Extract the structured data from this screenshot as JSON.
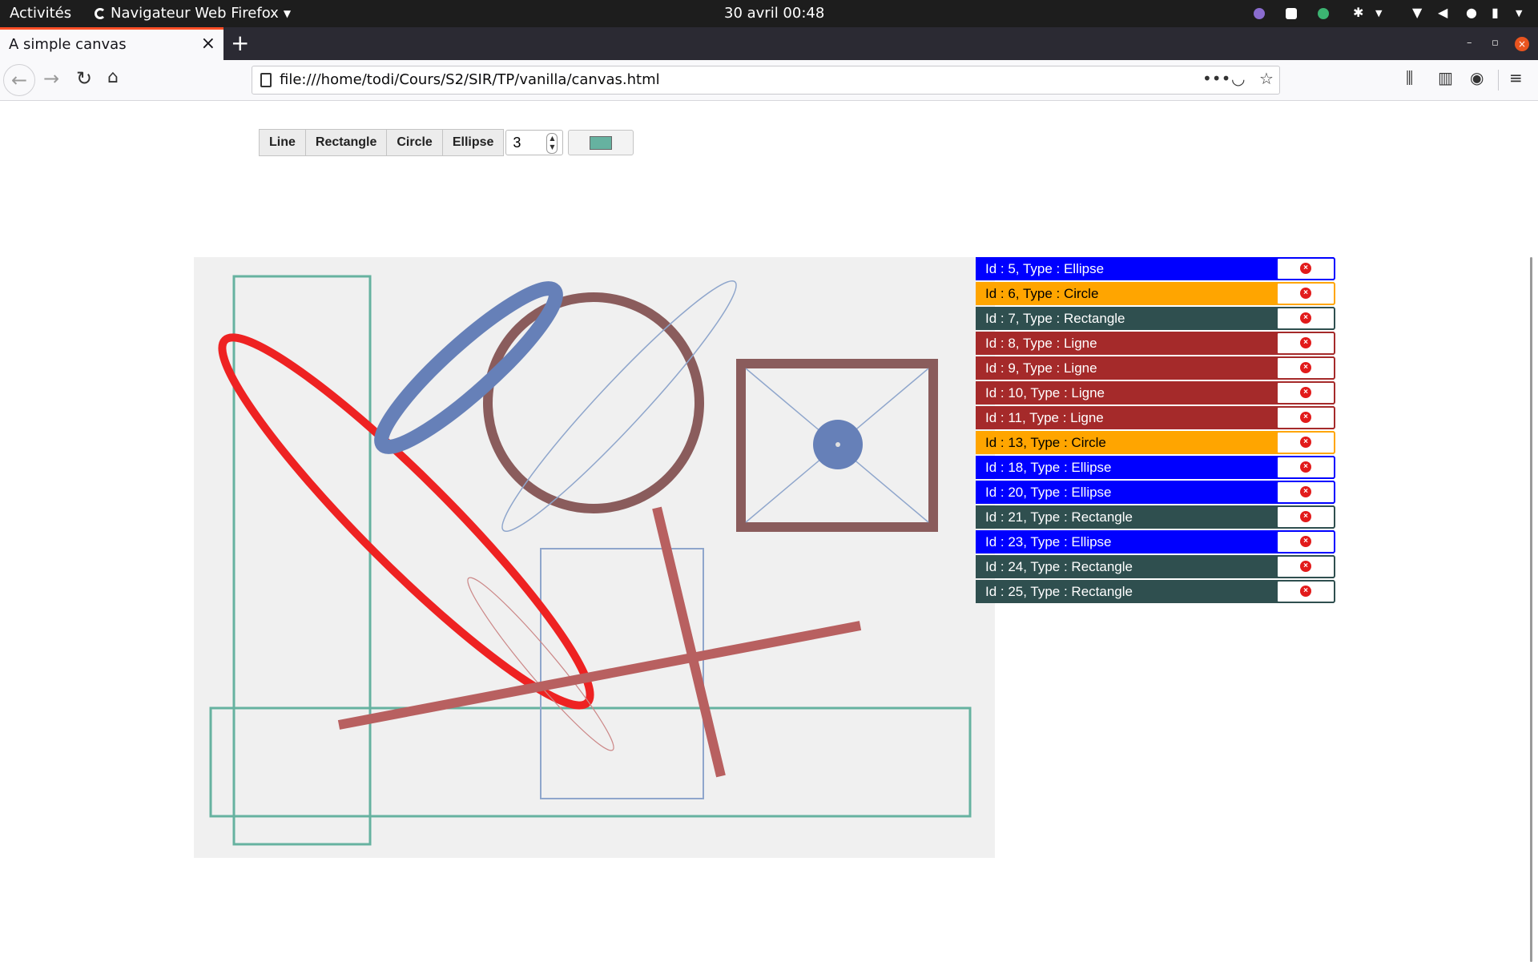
{
  "system_bar": {
    "activities": "Activités",
    "app_menu": "Navigateur Web Firefox",
    "clock": "30 avril  00:48"
  },
  "browser": {
    "tab_title": "A simple canvas",
    "url": "file:///home/todi/Cours/S2/SIR/TP/vanilla/canvas.html",
    "url_actions": [
      "more-actions-icon",
      "pocket-icon",
      "bookmark-star-icon"
    ],
    "toolbar_icons": [
      "library-icon",
      "sidebar-icon",
      "account-icon",
      "hamburger-menu-icon"
    ]
  },
  "toolbar": {
    "buttons": [
      "Line",
      "Rectangle",
      "Circle",
      "Ellipse"
    ],
    "thickness": "3",
    "color": "#66b2a0"
  },
  "shapes": [
    {
      "label": "Id : 5, Type : Ellipse",
      "bg": "#0000ff",
      "fg": "#ffffff",
      "border": "#0000ff"
    },
    {
      "label": "Id : 6, Type : Circle",
      "bg": "#ffa500",
      "fg": "#000000",
      "border": "#ffa500"
    },
    {
      "label": "Id : 7, Type : Rectangle",
      "bg": "#2f4f4f",
      "fg": "#ffffff",
      "border": "#2f4f4f"
    },
    {
      "label": "Id : 8, Type : Ligne",
      "bg": "#a52a2a",
      "fg": "#ffffff",
      "border": "#a52a2a"
    },
    {
      "label": "Id : 9, Type : Ligne",
      "bg": "#a52a2a",
      "fg": "#ffffff",
      "border": "#a52a2a"
    },
    {
      "label": "Id : 10, Type : Ligne",
      "bg": "#a52a2a",
      "fg": "#ffffff",
      "border": "#a52a2a"
    },
    {
      "label": "Id : 11, Type : Ligne",
      "bg": "#a52a2a",
      "fg": "#ffffff",
      "border": "#a52a2a"
    },
    {
      "label": "Id : 13, Type : Circle",
      "bg": "#ffa500",
      "fg": "#000000",
      "border": "#ffa500"
    },
    {
      "label": "Id : 18, Type : Ellipse",
      "bg": "#0000ff",
      "fg": "#ffffff",
      "border": "#0000ff"
    },
    {
      "label": "Id : 20, Type : Ellipse",
      "bg": "#0000ff",
      "fg": "#ffffff",
      "border": "#0000ff"
    },
    {
      "label": "Id : 21, Type : Rectangle",
      "bg": "#2f4f4f",
      "fg": "#ffffff",
      "border": "#2f4f4f"
    },
    {
      "label": "Id : 23, Type : Ellipse",
      "bg": "#0000ff",
      "fg": "#ffffff",
      "border": "#0000ff"
    },
    {
      "label": "Id : 24, Type : Rectangle",
      "bg": "#2f4f4f",
      "fg": "#ffffff",
      "border": "#2f4f4f"
    },
    {
      "label": "Id : 25, Type : Rectangle",
      "bg": "#2f4f4f",
      "fg": "#ffffff",
      "border": "#2f4f4f"
    }
  ],
  "canvas": {
    "background": "#f0f0f0",
    "stroke_colors": {
      "teal": "#66b2a0",
      "red": "#ee2222",
      "steel_blue": "#6680b8",
      "brown": "#8a5c5c",
      "light_blue": "#8fa6cc",
      "rose": "#b86060",
      "rose_light": "#cc8888"
    }
  }
}
